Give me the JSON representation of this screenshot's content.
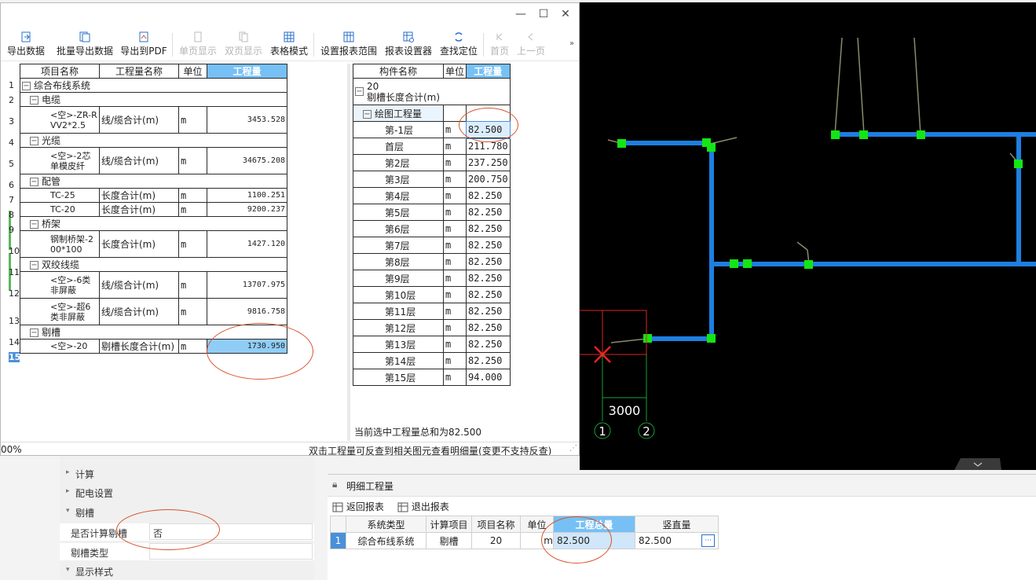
{
  "toolbar": {
    "export_data": "导出数据",
    "batch_export": "批量导出数据",
    "export_pdf": "导出到PDF",
    "single_page": "单页显示",
    "double_page": "双页显示",
    "table_mode": "表格模式",
    "report_range": "设置报表范围",
    "report_settings": "报表设置器",
    "find_locate": "查找定位",
    "first_page": "首页",
    "prev_page": "上一页"
  },
  "left_table": {
    "headers": [
      "项目名称",
      "工程量名称",
      "单位",
      "工程量"
    ],
    "rows": [
      {
        "n": "1",
        "name": "综合布线系统",
        "expander": true,
        "level": 0
      },
      {
        "n": "2",
        "name": "电缆",
        "expander": true,
        "level": 1
      },
      {
        "n": "3",
        "name": "<空>-ZR-RVV2*2.5",
        "qty_name": "线/缆合计(m)",
        "unit": "m",
        "qty": "3453.528",
        "level": 2
      },
      {
        "n": "4",
        "name": "光缆",
        "expander": true,
        "level": 1
      },
      {
        "n": "5",
        "name": "<空>-2芯单模皮纤",
        "qty_name": "线/缆合计(m)",
        "unit": "m",
        "qty": "34675.208",
        "level": 2
      },
      {
        "n": "6",
        "name": "配管",
        "expander": true,
        "level": 1
      },
      {
        "n": "7",
        "name": "TC-25",
        "qty_name": "长度合计(m)",
        "unit": "m",
        "qty": "1100.251",
        "level": 2
      },
      {
        "n": "8",
        "name": "TC-20",
        "qty_name": "长度合计(m)",
        "unit": "m",
        "qty": "9200.237",
        "level": 2
      },
      {
        "n": "9",
        "name": "桥架",
        "expander": true,
        "level": 1
      },
      {
        "n": "10",
        "name": "钢制桥架-200*100",
        "qty_name": "长度合计(m)",
        "unit": "m",
        "qty": "1427.120",
        "level": 2
      },
      {
        "n": "11",
        "name": "双绞线缆",
        "expander": true,
        "level": 1
      },
      {
        "n": "12",
        "name": "<空>-6类非屏蔽",
        "qty_name": "线/缆合计(m)",
        "unit": "m",
        "qty": "13707.975",
        "level": 2
      },
      {
        "n": "13",
        "name": "<空>-超6类非屏蔽",
        "qty_name": "线/缆合计(m)",
        "unit": "m",
        "qty": "9816.758",
        "level": 2
      },
      {
        "n": "14",
        "name": "剔槽",
        "expander": true,
        "level": 1
      },
      {
        "n": "15",
        "name": "<空>-20",
        "qty_name": "剔槽长度合计(m)",
        "unit": "m",
        "qty": "1730.950",
        "level": 2,
        "selected": true
      }
    ]
  },
  "right_table": {
    "headers": [
      "构件名称",
      "单位",
      "工程量"
    ],
    "root_line1": "20",
    "root_line2": "剔槽长度合计(m)",
    "group": "绘图工程量",
    "rows": [
      {
        "name": "第-1层",
        "unit": "m",
        "qty": "82.500",
        "selected": true
      },
      {
        "name": "首层",
        "unit": "m",
        "qty": "211.780"
      },
      {
        "name": "第2层",
        "unit": "m",
        "qty": "237.250"
      },
      {
        "name": "第3层",
        "unit": "m",
        "qty": "200.750"
      },
      {
        "name": "第4层",
        "unit": "m",
        "qty": "82.250"
      },
      {
        "name": "第5层",
        "unit": "m",
        "qty": "82.250"
      },
      {
        "name": "第6层",
        "unit": "m",
        "qty": "82.250"
      },
      {
        "name": "第7层",
        "unit": "m",
        "qty": "82.250"
      },
      {
        "name": "第8层",
        "unit": "m",
        "qty": "82.250"
      },
      {
        "name": "第9层",
        "unit": "m",
        "qty": "82.250"
      },
      {
        "name": "第10层",
        "unit": "m",
        "qty": "82.250"
      },
      {
        "name": "第11层",
        "unit": "m",
        "qty": "82.250"
      },
      {
        "name": "第12层",
        "unit": "m",
        "qty": "82.250"
      },
      {
        "name": "第13层",
        "unit": "m",
        "qty": "82.250"
      },
      {
        "name": "第14层",
        "unit": "m",
        "qty": "82.250"
      },
      {
        "name": "第15层",
        "unit": "m",
        "qty": "94.000"
      }
    ]
  },
  "status": {
    "selection_total": "当前选中工程量总和为82.500",
    "zoom": "00%",
    "hint": "双击工程量可反查到相关图元查看明细量(变更不支持反查)"
  },
  "properties": {
    "calc": "计算",
    "power_settings": "配电设置",
    "groove": "剔槽",
    "calc_groove_label": "是否计算剔槽",
    "calc_groove_value": "否",
    "groove_type_label": "剔槽类型",
    "display_style": "显示样式"
  },
  "detail_panel": {
    "title": "明细工程量",
    "back": "返回报表",
    "exit": "退出报表",
    "headers": [
      "系统类型",
      "计算项目",
      "项目名称",
      "单位",
      "工程总量",
      "竖直量"
    ],
    "row": {
      "n": "1",
      "system": "综合布线系统",
      "item": "剔槽",
      "name": "20",
      "unit": "m",
      "total": "82.500",
      "vertical": "82.500"
    },
    "more": "···"
  },
  "cad": {
    "dimension": "3000",
    "axis1": "1",
    "axis2": "2",
    "pipe_color": "#1e7fe0",
    "node_color": "#14e614"
  }
}
